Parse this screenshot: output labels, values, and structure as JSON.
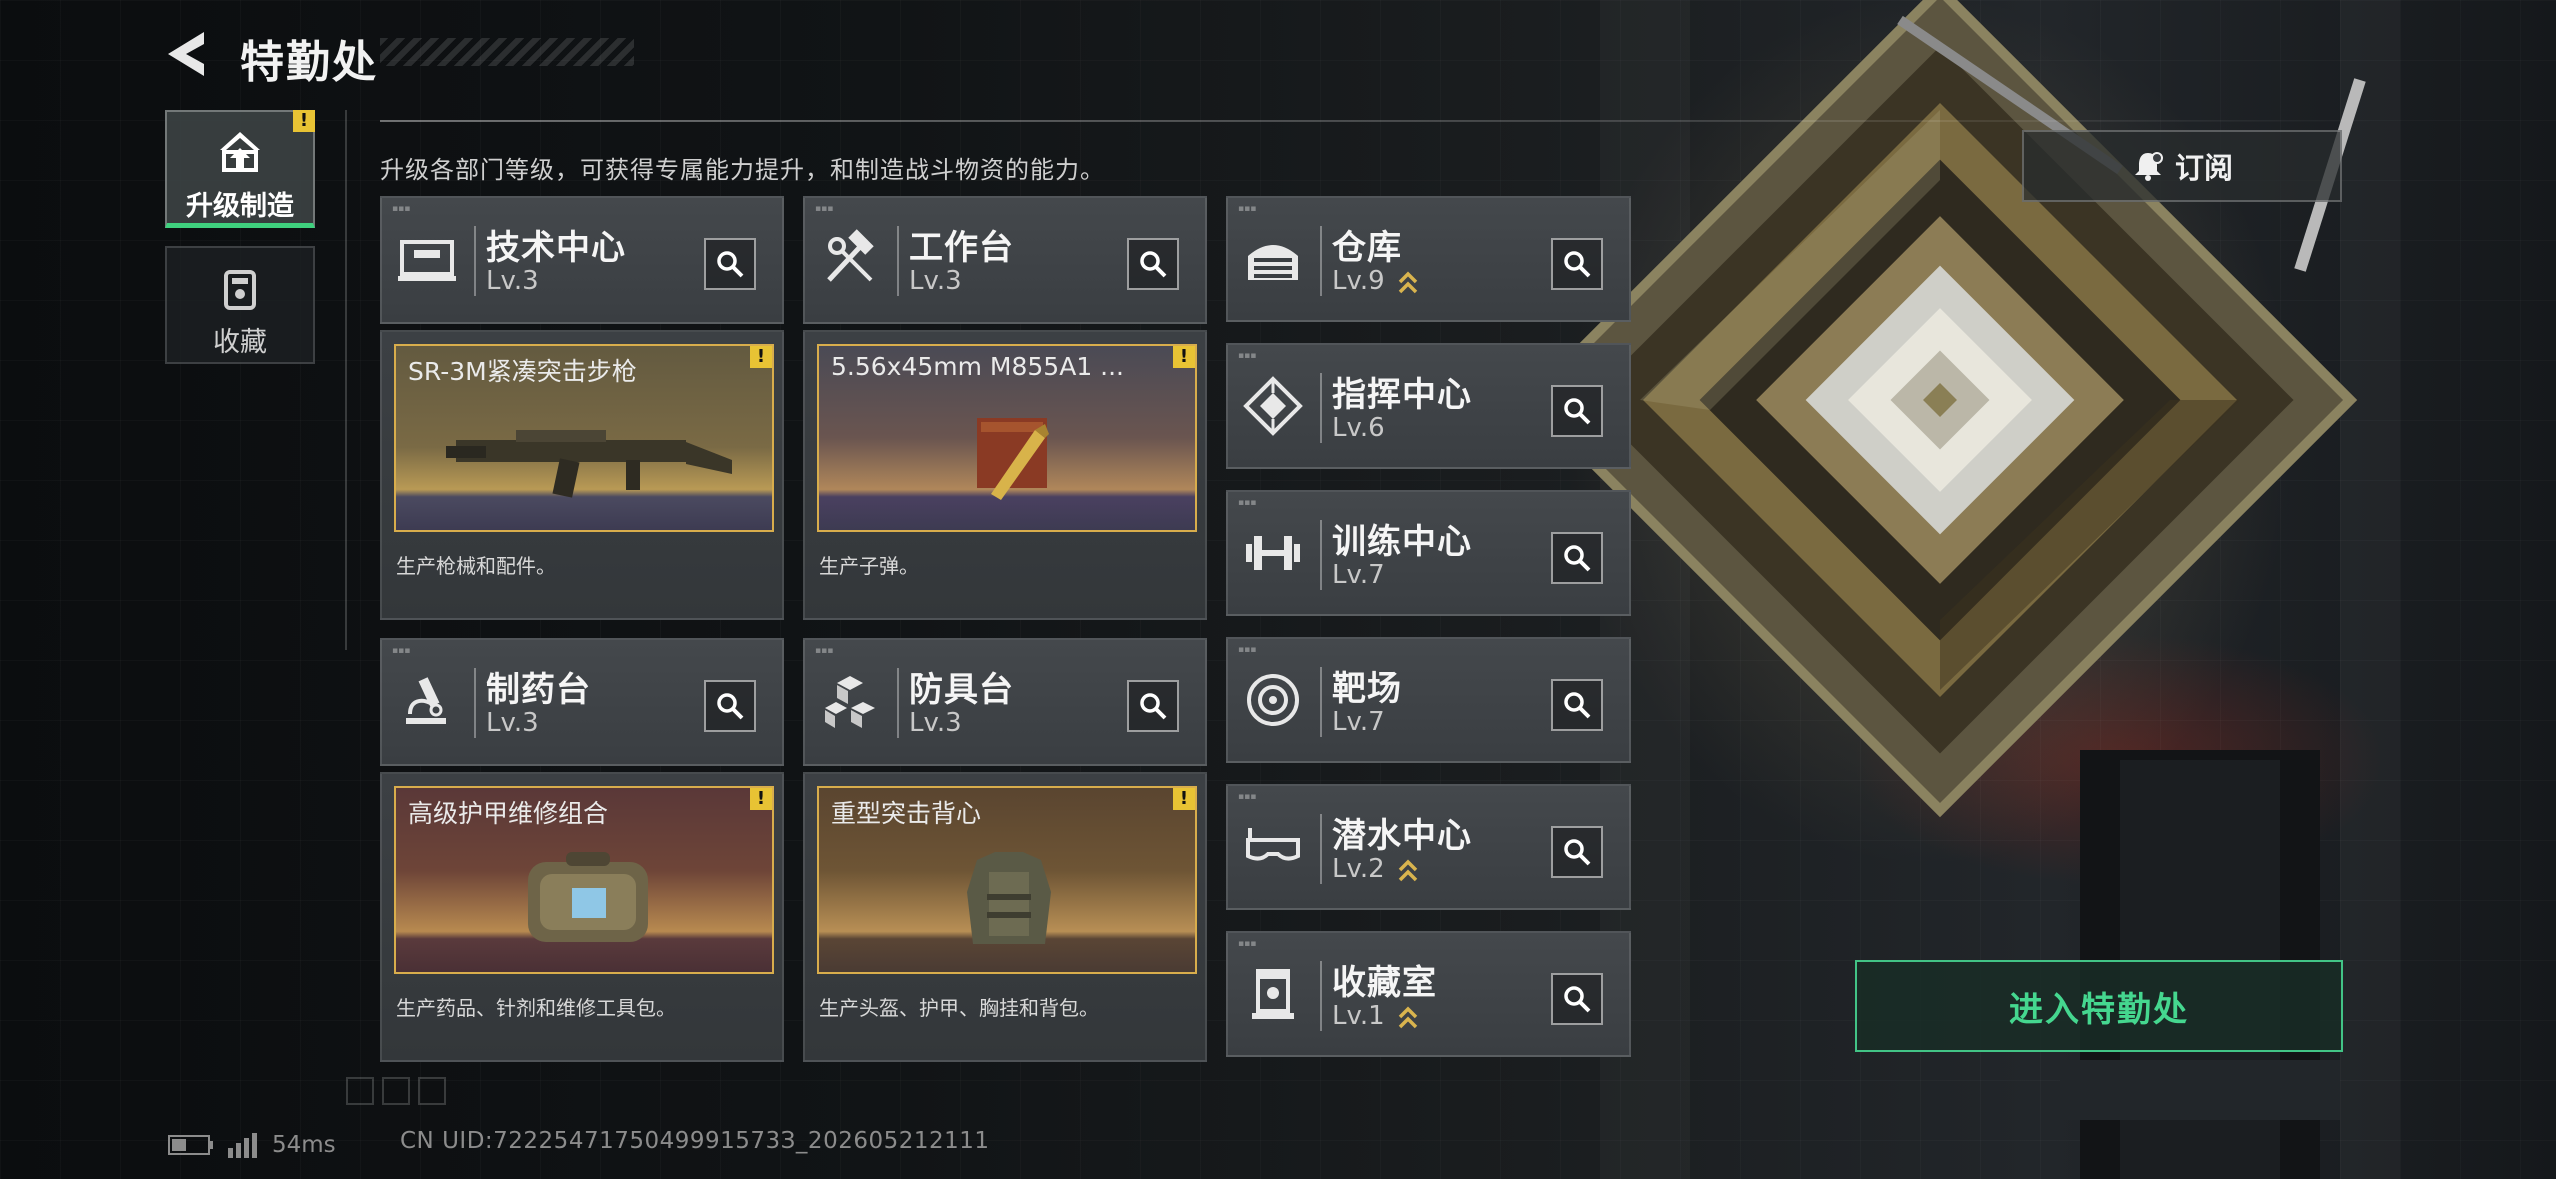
{
  "header": {
    "title": "特勤处"
  },
  "sidebar": {
    "tabs": [
      {
        "label": "升级制造",
        "active": true,
        "alert": "!"
      },
      {
        "label": "收藏",
        "active": false
      }
    ]
  },
  "description": "升级各部门等级，可获得专属能力提升，和制造战斗物资的能力。",
  "subscribe": {
    "label": "订阅"
  },
  "facilities": {
    "tech_center": {
      "name": "技术中心",
      "level": "Lv.3"
    },
    "workbench": {
      "name": "工作台",
      "level": "Lv.3"
    },
    "pharmacy": {
      "name": "制药台",
      "level": "Lv.3"
    },
    "armor_bench": {
      "name": "防具台",
      "level": "Lv.3"
    },
    "warehouse": {
      "name": "仓库",
      "level": "Lv.9",
      "upgradable": true
    },
    "command_center": {
      "name": "指挥中心",
      "level": "Lv.6"
    },
    "training_center": {
      "name": "训练中心",
      "level": "Lv.7"
    },
    "shooting_range": {
      "name": "靶场",
      "level": "Lv.7"
    },
    "diving_center": {
      "name": "潜水中心",
      "level": "Lv.2",
      "upgradable": true
    },
    "collection_room": {
      "name": "收藏室",
      "level": "Lv.1",
      "upgradable": true
    }
  },
  "production": {
    "tech_center": {
      "item": "SR-3M紧凑突击步枪",
      "desc": "生产枪械和配件。",
      "alert": "!"
    },
    "workbench": {
      "item": "5.56x45mm M855A1 ...",
      "desc": "生产子弹。",
      "alert": "!"
    },
    "pharmacy": {
      "item": "高级护甲维修组合",
      "desc": "生产药品、针剂和维修工具包。",
      "alert": "!"
    },
    "armor_bench": {
      "item": "重型突击背心",
      "desc": "生产头盔、护甲、胸挂和背包。",
      "alert": "!"
    }
  },
  "enter_button": {
    "label": "进入特勤处"
  },
  "status": {
    "ping": "54ms",
    "uid": "CN UID:7222547175049991573З_202605212111"
  },
  "colors": {
    "accent": "#42c486",
    "alert": "#e8c334",
    "item_border": "#d8ad4c"
  }
}
